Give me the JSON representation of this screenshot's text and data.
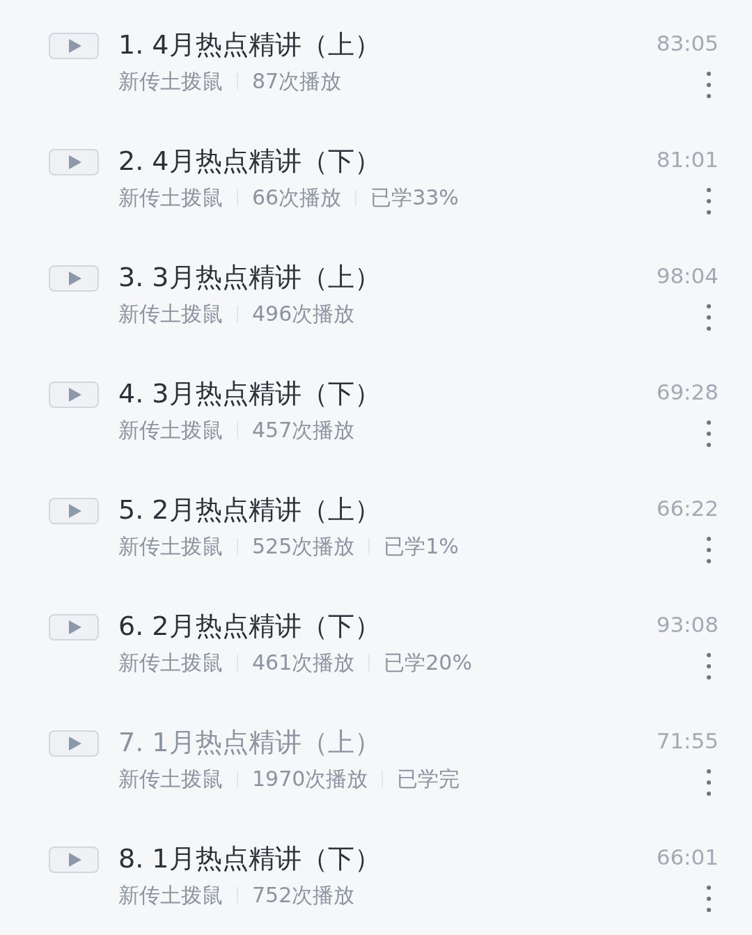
{
  "lessons": [
    {
      "title": "1. 4月热点精讲（上）",
      "author": "新传土拨鼠",
      "plays": "87次播放",
      "duration": "83:05",
      "finished": false
    },
    {
      "title": "2. 4月热点精讲（下）",
      "author": "新传土拨鼠",
      "plays": "66次播放",
      "progress": "已学33%",
      "duration": "81:01",
      "finished": false
    },
    {
      "title": "3. 3月热点精讲（上）",
      "author": "新传土拨鼠",
      "plays": "496次播放",
      "duration": "98:04",
      "finished": false
    },
    {
      "title": "4. 3月热点精讲（下）",
      "author": "新传土拨鼠",
      "plays": "457次播放",
      "duration": "69:28",
      "finished": false
    },
    {
      "title": "5. 2月热点精讲（上）",
      "author": "新传土拨鼠",
      "plays": "525次播放",
      "progress": "已学1%",
      "duration": "66:22",
      "finished": false
    },
    {
      "title": "6. 2月热点精讲（下）",
      "author": "新传土拨鼠",
      "plays": "461次播放",
      "progress": "已学20%",
      "duration": "93:08",
      "finished": false
    },
    {
      "title": "7. 1月热点精讲（上）",
      "author": "新传土拨鼠",
      "plays": "1970次播放",
      "progress": "已学完",
      "duration": "71:55",
      "finished": true
    },
    {
      "title": "8. 1月热点精讲（下）",
      "author": "新传土拨鼠",
      "plays": "752次播放",
      "duration": "66:01",
      "finished": false
    }
  ]
}
